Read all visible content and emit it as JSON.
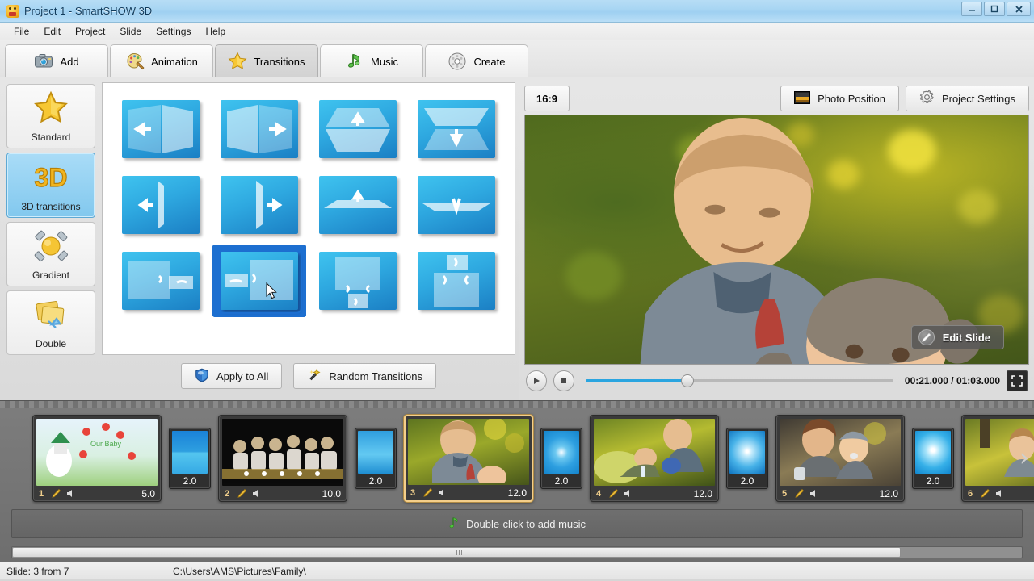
{
  "window": {
    "title": "Project 1 - SmartSHOW 3D",
    "app_icon": "app-icon",
    "minimize": "—",
    "maximize": "▢",
    "close": "✕"
  },
  "menu": {
    "items": [
      "File",
      "Edit",
      "Project",
      "Slide",
      "Settings",
      "Help"
    ]
  },
  "tabs": [
    {
      "label": "Add",
      "icon": "camera-icon",
      "active": false
    },
    {
      "label": "Animation",
      "icon": "palette-icon",
      "active": false
    },
    {
      "label": "Transitions",
      "icon": "star-icon",
      "active": true
    },
    {
      "label": "Music",
      "icon": "music-note-icon",
      "active": false
    },
    {
      "label": "Create",
      "icon": "disc-icon",
      "active": false
    }
  ],
  "categories": [
    {
      "label": "Standard",
      "icon": "star-icon",
      "selected": false
    },
    {
      "label": "3D transitions",
      "icon": "3d-text-icon",
      "selected": true
    },
    {
      "label": "Gradient",
      "icon": "gradient-sphere-icon",
      "selected": false
    },
    {
      "label": "Double",
      "icon": "double-cards-icon",
      "selected": false
    }
  ],
  "transitions_grid": {
    "rows": 3,
    "columns": 4,
    "selected_index": 9,
    "items": [
      {
        "name": "door-fold-left"
      },
      {
        "name": "door-fold-right"
      },
      {
        "name": "box-fold-up"
      },
      {
        "name": "box-fold-down"
      },
      {
        "name": "flip-vertical-left"
      },
      {
        "name": "flip-vertical-right"
      },
      {
        "name": "fold-horizontal-up"
      },
      {
        "name": "fold-horizontal-down"
      },
      {
        "name": "slide-panels-right"
      },
      {
        "name": "slide-panels-left"
      },
      {
        "name": "drop-panel-down"
      },
      {
        "name": "lift-panel-up"
      }
    ]
  },
  "panel_buttons": {
    "apply_to_all": "Apply to All",
    "random_transitions": "Random Transitions"
  },
  "preview": {
    "aspect_ratio": "16:9",
    "photo_position": "Photo Position",
    "project_settings": "Project Settings",
    "edit_slide": "Edit Slide",
    "playback": {
      "play_icon": "play-icon",
      "stop_icon": "stop-icon",
      "progress_percent": 33,
      "current_time": "00:21.000",
      "total_time": "01:03.000",
      "timecode": "00:21.000 / 01:03.000",
      "fullscreen_icon": "fullscreen-icon"
    }
  },
  "timeline": {
    "slides": [
      {
        "number": "1",
        "duration": "5.0",
        "selected": false,
        "thumb": "baby-poster"
      },
      {
        "number": "2",
        "duration": "10.0",
        "selected": false,
        "thumb": "dark-crowd"
      },
      {
        "number": "3",
        "duration": "12.0",
        "selected": true,
        "thumb": "man-portrait"
      },
      {
        "number": "4",
        "duration": "12.0",
        "selected": false,
        "thumb": "family-picnic"
      },
      {
        "number": "5",
        "duration": "12.0",
        "selected": false,
        "thumb": "mother-baby"
      },
      {
        "number": "6",
        "duration": "",
        "selected": false,
        "thumb": "baby-autumn"
      }
    ],
    "transitions": [
      {
        "duration": "2.0",
        "thumb": "fade-blue"
      },
      {
        "duration": "2.0",
        "thumb": "wipe-blue"
      },
      {
        "duration": "2.0",
        "thumb": "swirl-blue"
      },
      {
        "duration": "2.0",
        "thumb": "glow-blue"
      },
      {
        "duration": "2.0",
        "thumb": "star-blue"
      }
    ],
    "next_arrow": "›",
    "music_hint": "Double-click to add music",
    "music_icon": "music-note-icon",
    "scroll_percent": 88
  },
  "statusbar": {
    "slide_info": "Slide: 3 from 7",
    "path": "C:\\Users\\AMS\\Pictures\\Family\\"
  },
  "colors": {
    "title_blue": "#a9d6f3",
    "selection_blue": "#1d6fd0",
    "category_selected": "#82c8ee",
    "accent_cyan": "#2aa5e0",
    "slide_selected_border": "#f4cf8a",
    "timeline_bg": "#6e6e6e"
  }
}
